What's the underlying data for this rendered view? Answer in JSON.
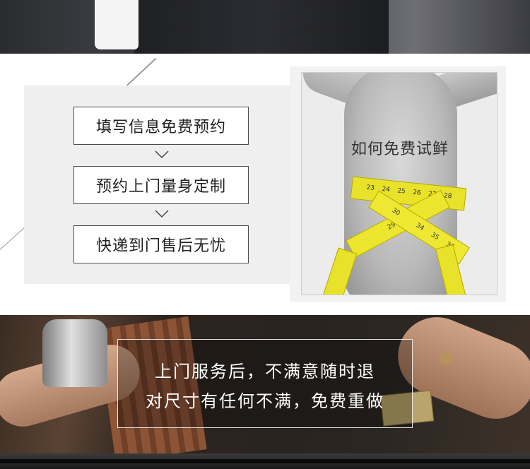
{
  "steps": [
    {
      "label": "填写信息免费预约"
    },
    {
      "label": "预约上门量身定制"
    },
    {
      "label": "快递到门售后无忧"
    }
  ],
  "photo": {
    "caption": "如何免费试鲜",
    "tape_numbers": [
      "23",
      "24",
      "25",
      "26",
      "27",
      "28",
      "29",
      "30",
      "34",
      "35",
      "36"
    ]
  },
  "service": {
    "line1": "上门服务后，不满意随时退",
    "line2": "对尺寸有任何不满，免费重做"
  },
  "colors": {
    "tape": "#e8e22a",
    "panel": "#efefef",
    "box_border": "#4a4a4a"
  }
}
